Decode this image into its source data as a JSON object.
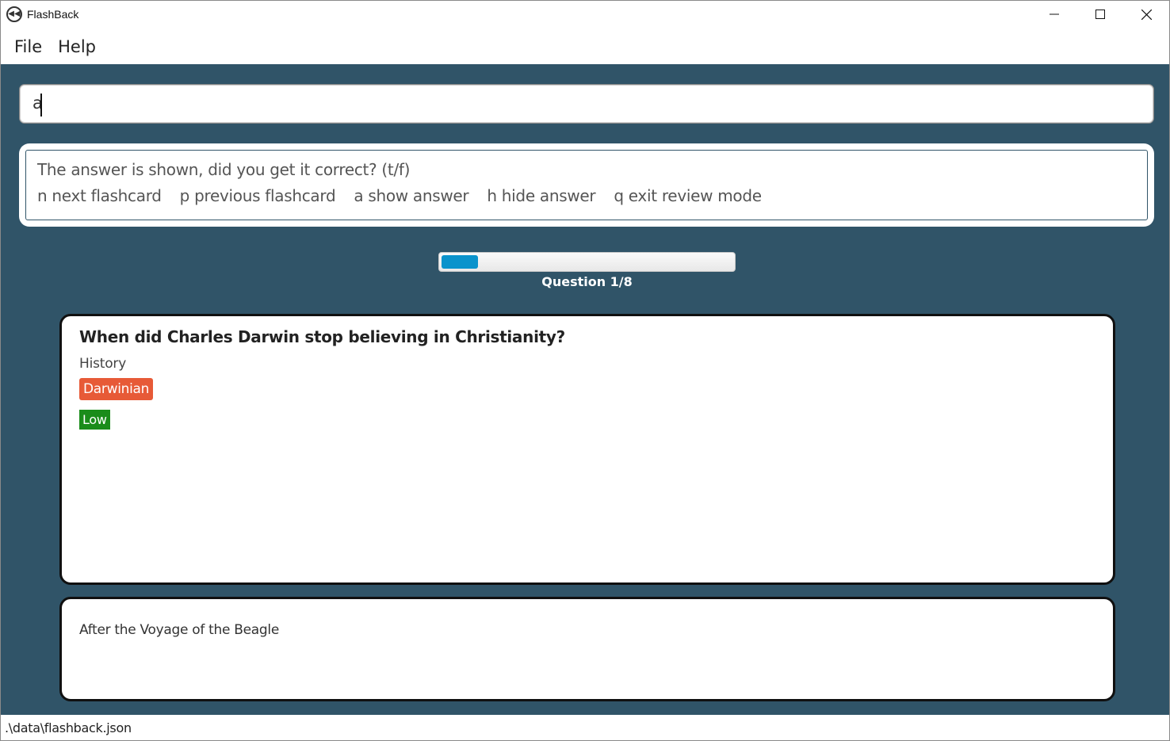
{
  "window": {
    "title": "FlashBack",
    "icon": "rewind-icon"
  },
  "menu": {
    "items": [
      "File",
      "Help"
    ]
  },
  "command": {
    "value": "a"
  },
  "result": {
    "line1": "The answer is shown, did you get it correct? (t/f)",
    "hints": [
      "n next flashcard",
      "p previous flashcard",
      "a show answer",
      "h hide answer",
      "q exit review mode"
    ]
  },
  "progress": {
    "current": 1,
    "total": 8,
    "fraction": 0.125,
    "label": "Question 1/8",
    "color": "#0a93cc"
  },
  "flashcard": {
    "question": "When did Charles Darwin stop believing in Christianity?",
    "category": "History",
    "tag": "Darwinian",
    "tag_color": "#e75a37",
    "priority": "Low",
    "priority_color": "#1a8c1a",
    "answer": "After the Voyage of the Beagle"
  },
  "status": {
    "file_path": ".\\data\\flashback.json"
  },
  "colors": {
    "background": "#305468"
  }
}
